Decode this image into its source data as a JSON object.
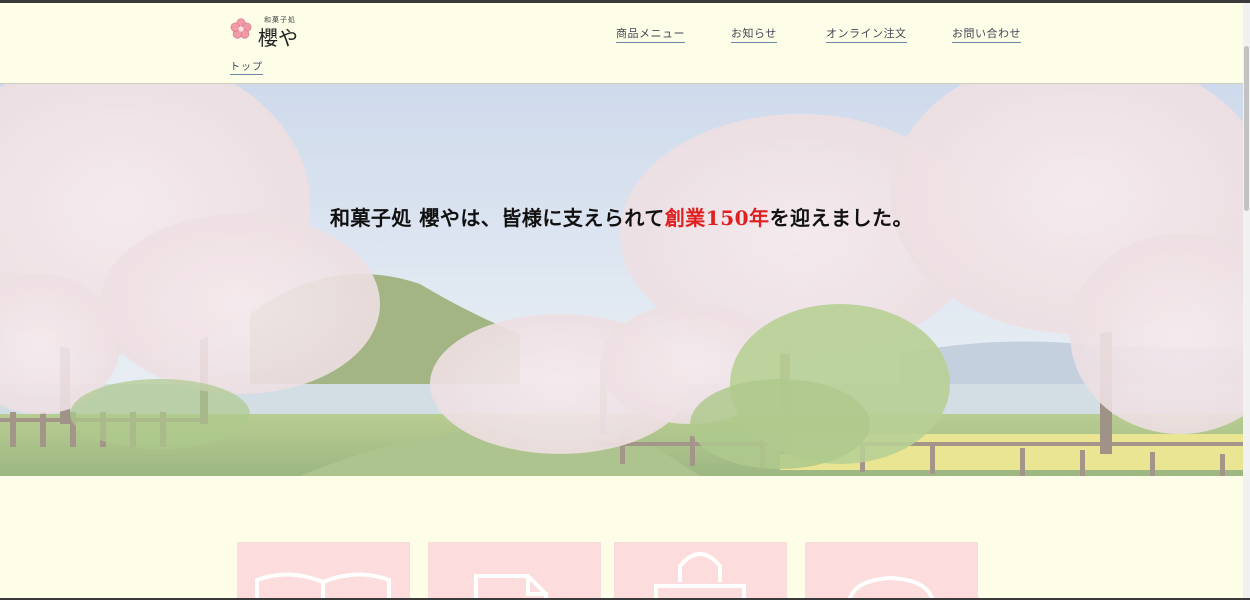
{
  "logo": {
    "subtitle": "和菓子処",
    "name": "櫻や",
    "icon": "sakura-flower-icon"
  },
  "nav": {
    "items": [
      {
        "label": "商品メニュー"
      },
      {
        "label": "お知らせ"
      },
      {
        "label": "オンライン注文"
      },
      {
        "label": "お問い合わせ"
      }
    ]
  },
  "breadcrumb": {
    "label": "トップ"
  },
  "hero": {
    "text_before": "和菓子処 櫻やは、皆様に支えられて",
    "text_accent": "創業150年",
    "text_after": "を迎えました。",
    "image": "cherry-blossom-avenue-photo"
  },
  "cards": [
    {
      "icon": "open-book-icon"
    },
    {
      "icon": "document-icon"
    },
    {
      "icon": "shopping-bag-icon"
    },
    {
      "icon": "speech-bubble-icon"
    }
  ],
  "colors": {
    "background": "#fefee8",
    "accent": "#e02020",
    "card": "#fcdcdc",
    "link_underline": "#6c86a6"
  }
}
